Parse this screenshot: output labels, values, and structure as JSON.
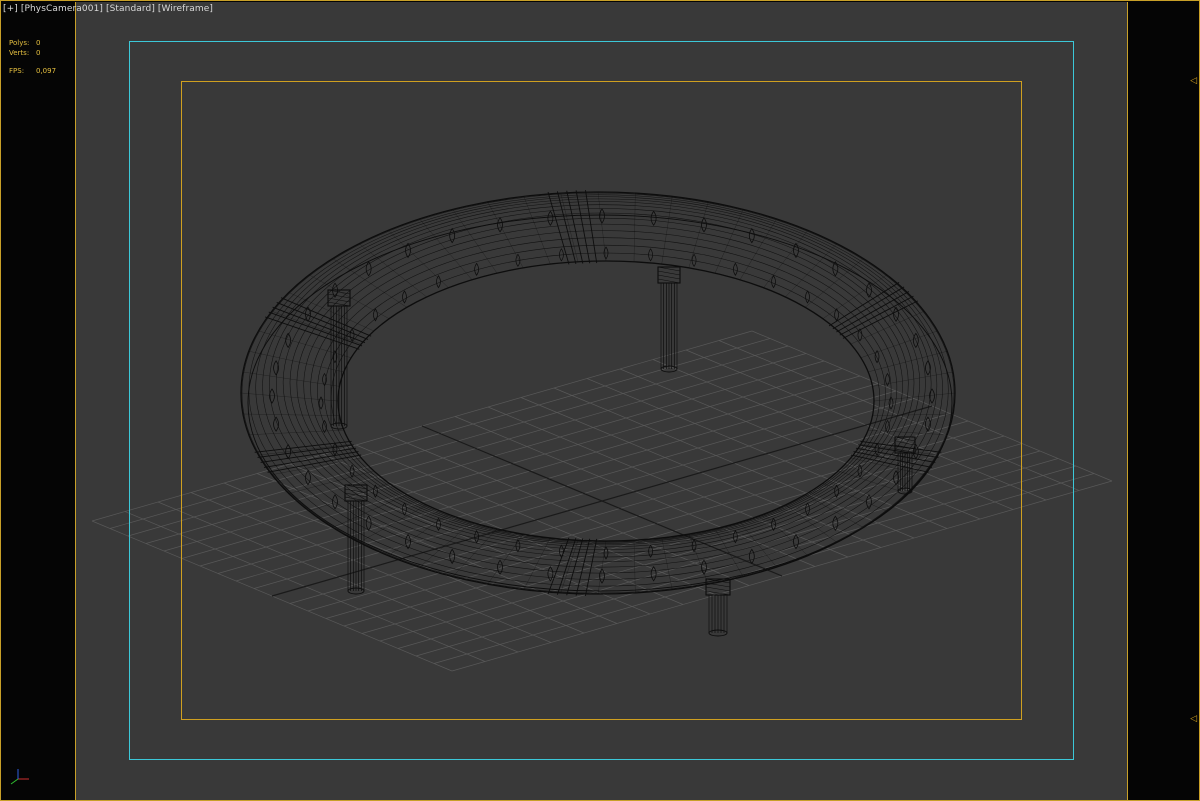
{
  "viewport": {
    "label_plus": "[+]",
    "label_camera": "[PhysCamera001]",
    "label_shading": "[Standard]",
    "label_mode": "[Wireframe]"
  },
  "stats": {
    "polys_label": "Polys:",
    "polys_value": "0",
    "verts_label": "Verts:",
    "verts_value": "0",
    "fps_label": "FPS:",
    "fps_value": "0,097"
  },
  "colors": {
    "viewport_bg": "#393939",
    "active_border": "#c8a028",
    "safe_frame_outer": "#3cc8d8",
    "safe_frame_inner": "#d0a020",
    "stats_text": "#e6c040",
    "wire": "#0a0a0a",
    "grid": "#5a5a5a"
  },
  "icons": {
    "right_marker_top": "triangle-left-icon",
    "right_marker_bottom": "triangle-left-icon",
    "axis": "axis-tripod-icon"
  }
}
